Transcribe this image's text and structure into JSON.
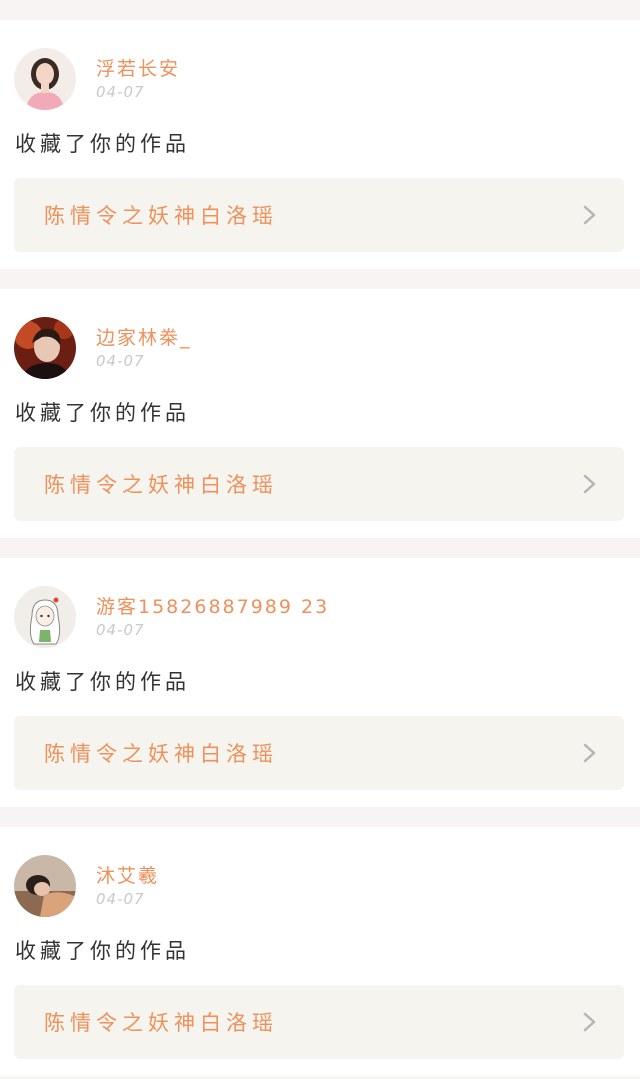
{
  "feed": {
    "items": [
      {
        "user_name": "浮若长安",
        "time": "04-07",
        "action": "收藏了你的作品",
        "work_title": "陈情令之妖神白洛瑶",
        "avatar_icon": "avatar-woman-pink-dress-icon"
      },
      {
        "user_name": "边家林桊_",
        "time": "04-07",
        "action": "收藏了你的作品",
        "work_title": "陈情令之妖神白洛瑶",
        "avatar_icon": "avatar-man-red-background-icon"
      },
      {
        "user_name": "游客15826887989 23",
        "time": "04-07",
        "action": "收藏了你的作品",
        "work_title": "陈情令之妖神白洛瑶",
        "avatar_icon": "avatar-cartoon-girl-icon"
      },
      {
        "user_name": "沐艾羲",
        "time": "04-07",
        "action": "收藏了你的作品",
        "work_title": "陈情令之妖神白洛瑶",
        "avatar_icon": "avatar-person-lying-icon"
      }
    ]
  },
  "colors": {
    "accent": "#f0905a",
    "time": "#c9c9c9",
    "text": "#333333",
    "link_bg": "#f5f4ef",
    "page_bg": "#f7f4f3"
  }
}
